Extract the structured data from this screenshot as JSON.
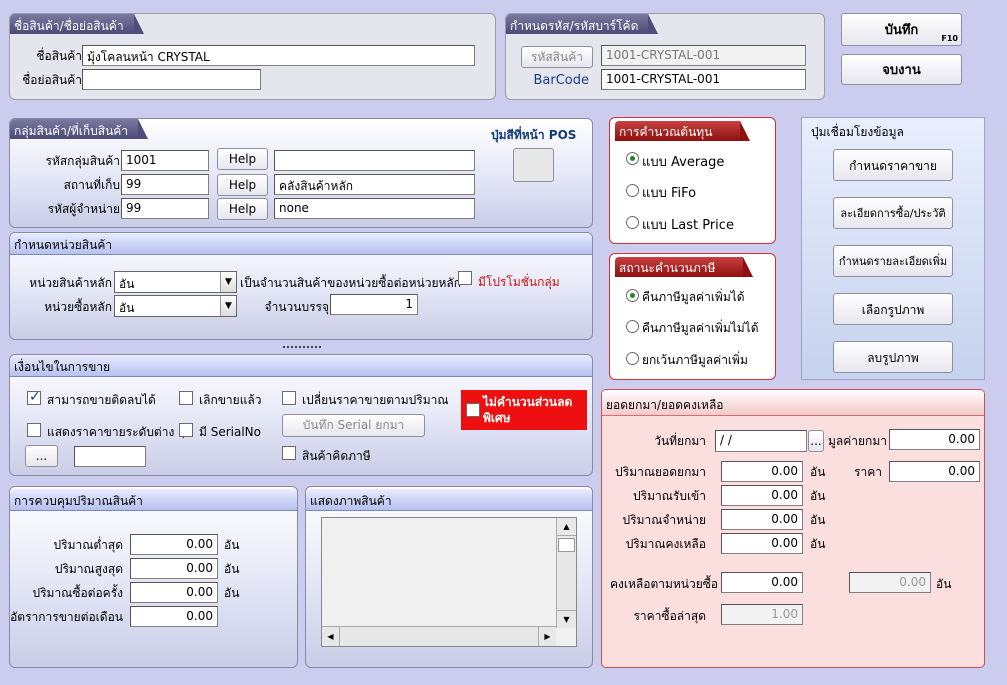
{
  "product_name": {
    "title": "ชื่อสินค้า/ชื่อย่อสินค้า",
    "name_label": "ชื่อสินค้า",
    "name_value": "มุ้งโคลนหน้า CRYSTAL",
    "short_label": "ชื่อย่อสินค้า",
    "short_value": ""
  },
  "code": {
    "title": "กำหนดรหัส/รหัสบาร์โค้ด",
    "code_button": "รหัสสินค้า",
    "code_value": "1001-CRYSTAL-001",
    "barcode_label": "BarCode",
    "barcode_value": "1001-CRYSTAL-001"
  },
  "actions": {
    "save": "บันทึก",
    "save_key": "F10",
    "exit": "จบงาน"
  },
  "group": {
    "title": "กลุ่มสินค้า/ที่เก็บสินค้า",
    "pos_label": "ปุ่มสีที่หน้า POS",
    "rows": [
      {
        "label": "รหัสกลุ่มสินค้า",
        "value": "1001",
        "help": "Help",
        "desc": ""
      },
      {
        "label": "สถานที่เก็บ",
        "value": "99",
        "help": "Help",
        "desc": "คลังสินค้าหลัก"
      },
      {
        "label": "รหัสผู้จำหน่าย",
        "value": "99",
        "help": "Help",
        "desc": "none"
      }
    ]
  },
  "unit": {
    "title": "กำหนดหน่วยสินค้า",
    "main_label": "หน่วยสินค้าหลัก",
    "main_value": "อัน",
    "main_note": "เป็นจำนวนสินค้าของหน่วยซื้อต่อหน่วยหลัก",
    "promo_label": "มีโปรโมชั่นกลุ่ม",
    "buy_label": "หน่วยซื้อหลัก",
    "buy_value": "อัน",
    "pack_label": "จำนวนบรรจุ",
    "pack_value": "1"
  },
  "sale": {
    "title": "เงื่อนไขในการขาย",
    "opt_negative": "สามารถขายติดลบได้",
    "opt_discontinued": "เลิกขายแล้ว",
    "opt_qty_price": "เปลี่ยนราคาขายตามปริมาณ",
    "opt_no_discount": "ไม่คำนวนส่วนลดพิเศษ",
    "opt_level_price": "แสดงราคาขายระดับต่าง ๆ",
    "opt_serial": "มี SerialNo",
    "serial_button": "บันทึก Serial ยกมา",
    "opt_taxable": "สินค้าคิดภาษี",
    "dots_button": "...",
    "checked_negative": true
  },
  "qty_control": {
    "title": "การควบคุมปริมาณสินค้า",
    "rows": [
      {
        "label": "ปริมาณต่ำสุด",
        "value": "0.00",
        "unit": "อัน"
      },
      {
        "label": "ปริมาณสูงสุด",
        "value": "0.00",
        "unit": "อัน"
      },
      {
        "label": "ปริมาณซื้อต่อครั้ง",
        "value": "0.00",
        "unit": "อัน"
      },
      {
        "label": "อัตราการขายต่อเดือน",
        "value": "0.00",
        "unit": ""
      }
    ]
  },
  "image_panel": {
    "title": "แสดงภาพสินค้า"
  },
  "cost": {
    "title": "การคำนวณต้นทุน",
    "options": [
      "แบบ Average",
      "แบบ FiFo",
      "แบบ Last Price"
    ],
    "selected": 0
  },
  "tax": {
    "title": "สถานะคำนวนภาษี",
    "options": [
      "คืนภาษีมูลค่าเพิ่มได้",
      "คืนภาษีมูลค่าเพิ่มไม่ได้",
      "ยกเว้นภาษีมูลค่าเพิ่ม"
    ],
    "selected": 0
  },
  "links": {
    "title": "ปุ่มเชื่อมโยงข้อมูล",
    "buttons": [
      "กำหนดราคาขาย",
      "ละเอียดการซื้อ/ประวัติ",
      "กำหนดรายละเอียดเพิ่ม",
      "เลือกรูปภาพ",
      "ลบรูปภาพ"
    ]
  },
  "balance": {
    "title": "ยอดยกมา/ยอดคงเหลือ",
    "date_label": "วันที่ยกมา",
    "date_value": "/  /",
    "date_button": "...",
    "value_label": "มูลค่ายกมา",
    "value_value": "0.00",
    "price_label": "ราคา",
    "price_value": "0.00",
    "rows": [
      {
        "label": "ปริมาณยอดยกมา",
        "value": "0.00",
        "unit": "อัน"
      },
      {
        "label": "ปริมาณรับเข้า",
        "value": "0.00",
        "unit": "อัน"
      },
      {
        "label": "ปริมาณจำหน่าย",
        "value": "0.00",
        "unit": "อัน"
      },
      {
        "label": "ปริมาณคงเหลือ",
        "value": "0.00",
        "unit": "อัน"
      }
    ],
    "remain_buy_label": "คงเหลือตามหน่วยซื้อ",
    "remain_buy_value": "0.00",
    "remain_buy_value2": "0.00",
    "remain_buy_unit": "อัน",
    "last_price_label": "ราคาซื้อล่าสุด",
    "last_price_value": "1.00"
  }
}
